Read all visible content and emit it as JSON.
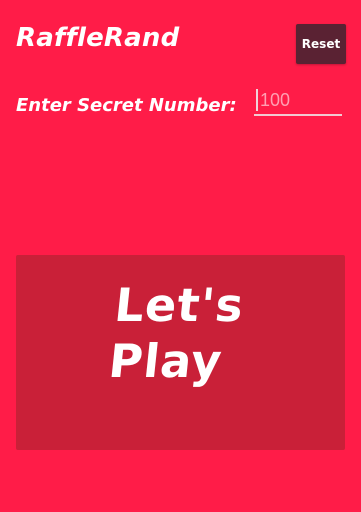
{
  "app": {
    "title": "RaffleRand"
  },
  "toolbar": {
    "reset_label": "Reset"
  },
  "secret": {
    "label": "Enter Secret Number:",
    "placeholder": "100",
    "value": ""
  },
  "play": {
    "label": "Let's\nPlay"
  },
  "colors": {
    "background": "#ff1c48",
    "reset_button": "#5a2233",
    "play_button": "#c92038"
  }
}
